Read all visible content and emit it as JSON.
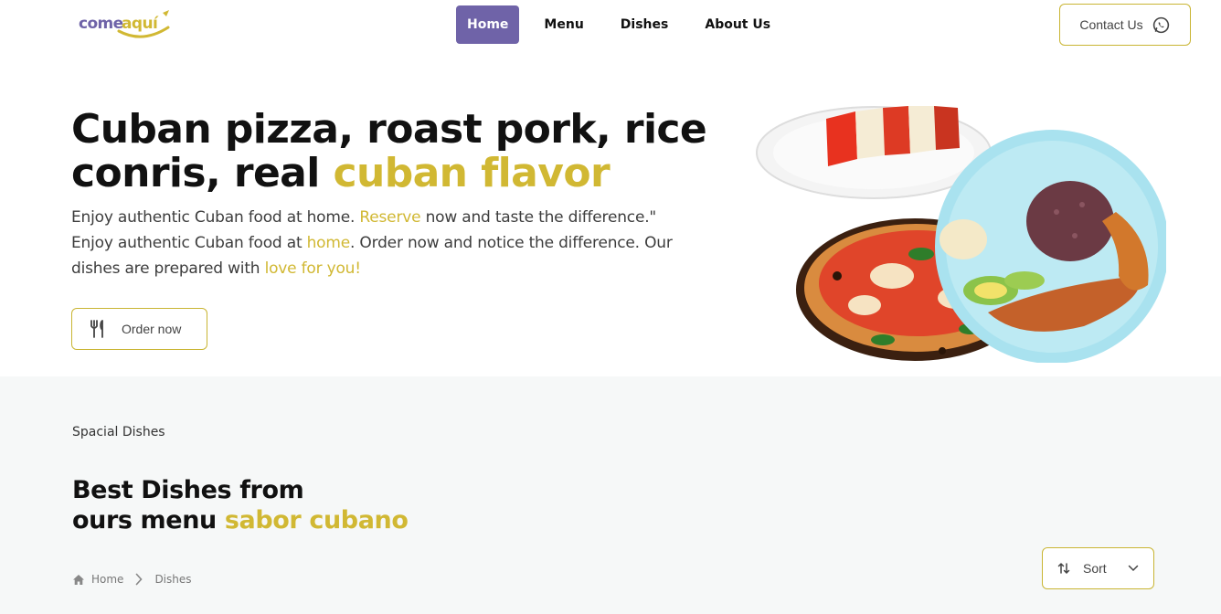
{
  "brand": {
    "logo_text_1": "come",
    "logo_text_2": "aquí"
  },
  "nav": {
    "items": [
      {
        "label": "Home",
        "active": true
      },
      {
        "label": "Menu",
        "active": false
      },
      {
        "label": "Dishes",
        "active": false
      },
      {
        "label": "About Us",
        "active": false
      }
    ],
    "contact_label": "Contact Us"
  },
  "hero": {
    "title_line_1": "Cuban pizza, roast pork, rice",
    "title_line_2_plain": "conris, real ",
    "title_line_2_accent": "cuban flavor",
    "desc_1": "Enjoy authentic Cuban food at home. ",
    "desc_accent_1": "Reserve",
    "desc_2": " now and taste the difference.\" Enjoy authentic Cuban food at ",
    "desc_accent_2": "home",
    "desc_3": ". Order now and notice the difference. Our dishes are prepared with ",
    "desc_accent_3": "love for you!",
    "order_label": "Order now"
  },
  "special": {
    "kicker": "Spacial Dishes",
    "title_line_1": "Best Dishes from",
    "title_line_2_plain": "ours menu ",
    "title_line_2_accent": "sabor cubano",
    "breadcrumb": {
      "home": "Home",
      "current": "Dishes"
    },
    "sort_label": "Sort"
  },
  "colors": {
    "accent": "#d1b833",
    "nav_active": "#6f63a8",
    "section_bg": "#f6f8f8",
    "button_border": "#c9b533"
  },
  "icons": {
    "contact": "whatsapp-icon",
    "order": "utensils-icon",
    "sort": "sort-icon",
    "dropdown": "chevron-down-icon",
    "breadcrumb_home": "home-icon",
    "breadcrumb_sep": "chevron-right-icon"
  }
}
